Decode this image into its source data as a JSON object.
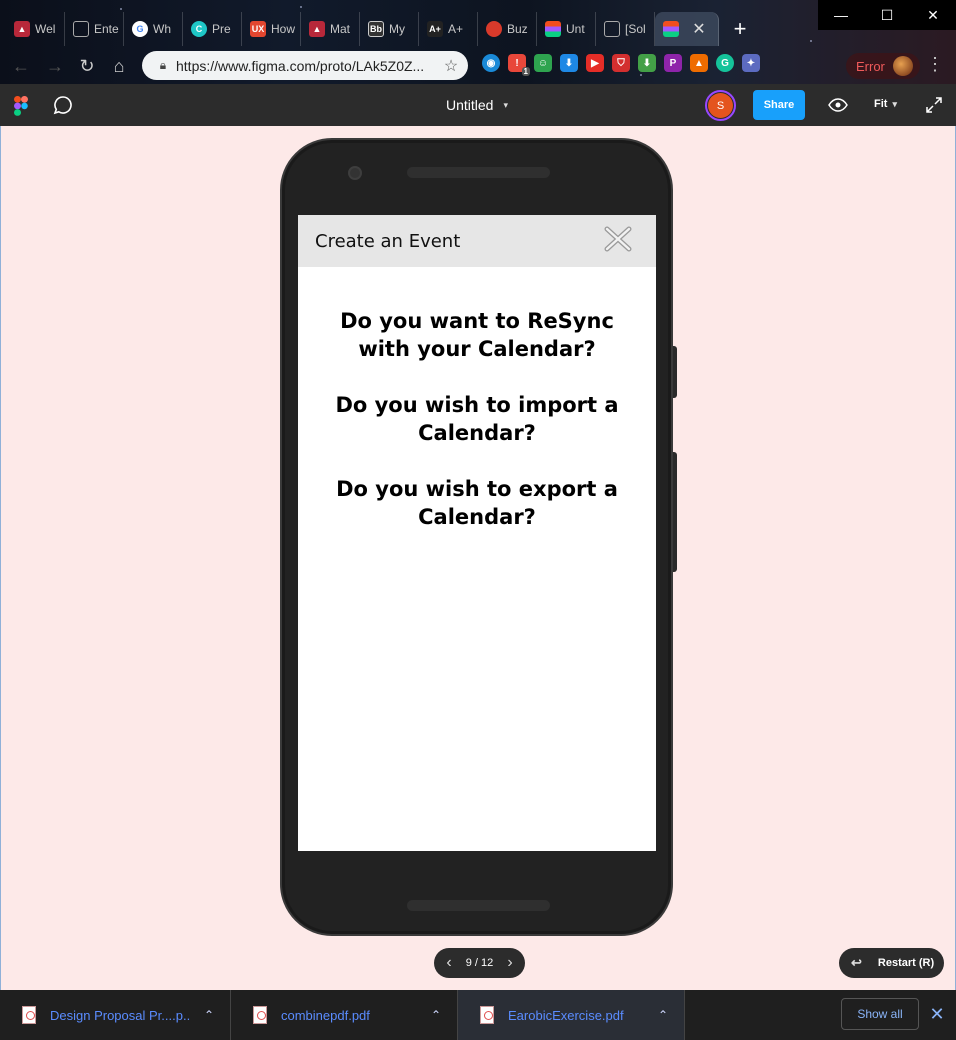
{
  "browser": {
    "tabs": [
      {
        "label": "Wel",
        "icon": "warning-app-icon",
        "color": "#b8283a"
      },
      {
        "label": "Ente",
        "icon": "document-icon",
        "color": "#666666"
      },
      {
        "label": "Wh",
        "icon": "google-icon",
        "color": "#ffffff"
      },
      {
        "label": "Pre",
        "icon": "canva-icon",
        "color": "#1ec6c6"
      },
      {
        "label": "How",
        "icon": "ux-icon",
        "color": "#e2462f"
      },
      {
        "label": "Mat",
        "icon": "warning-app-icon",
        "color": "#b8283a"
      },
      {
        "label": "My",
        "icon": "blackboard-icon",
        "color": "#333333"
      },
      {
        "label": "A+",
        "icon": "aplus-icon",
        "color": "#222222"
      },
      {
        "label": "Buz",
        "icon": "tomato-icon",
        "color": "#d93a2b"
      },
      {
        "label": "Unt",
        "icon": "figma-icon",
        "color": "#a259ff"
      },
      {
        "label": "[Sol",
        "icon": "document-icon",
        "color": "#666666"
      }
    ],
    "url": "https://www.figma.com/proto/LAk5Z0Z...",
    "error_label": "Error",
    "extensions": [
      {
        "name": "extension-circle",
        "color": "#1a8ad8"
      },
      {
        "name": "extension-grammar",
        "color": "#e8473a"
      },
      {
        "name": "extension-robot",
        "color": "#2ea44f"
      },
      {
        "name": "extension-download",
        "color": "#1e88e5"
      },
      {
        "name": "extension-youtube",
        "color": "#e52d27"
      },
      {
        "name": "extension-shield",
        "color": "#d32f2f"
      },
      {
        "name": "extension-save",
        "color": "#43a047"
      },
      {
        "name": "extension-p",
        "color": "#8e24aa"
      },
      {
        "name": "extension-fox",
        "color": "#ef6c00"
      },
      {
        "name": "extension-grammarly",
        "color": "#15c39a"
      },
      {
        "name": "extension-puzzle",
        "color": "#5c6bc0"
      }
    ],
    "extension_badge": "1"
  },
  "figma": {
    "file_title": "Untitled",
    "avatar_initial": "S",
    "share_label": "Share",
    "fit_label": "Fit",
    "accent": "#18a0fb",
    "avatar_color": "#e4541e"
  },
  "prototype": {
    "header_title": "Create an Event",
    "questions": [
      "Do you want to ReSync with your Calendar?",
      "Do you wish to import a Calendar?",
      "Do you wish to export a Calendar?"
    ],
    "pager": "9 / 12",
    "restart_label": "Restart (R)"
  },
  "downloads": {
    "items": [
      {
        "name": "Design Proposal Pr....p..."
      },
      {
        "name": "combinepdf.pdf"
      },
      {
        "name": "EarobicExercise.pdf"
      }
    ],
    "show_all_label": "Show all"
  }
}
